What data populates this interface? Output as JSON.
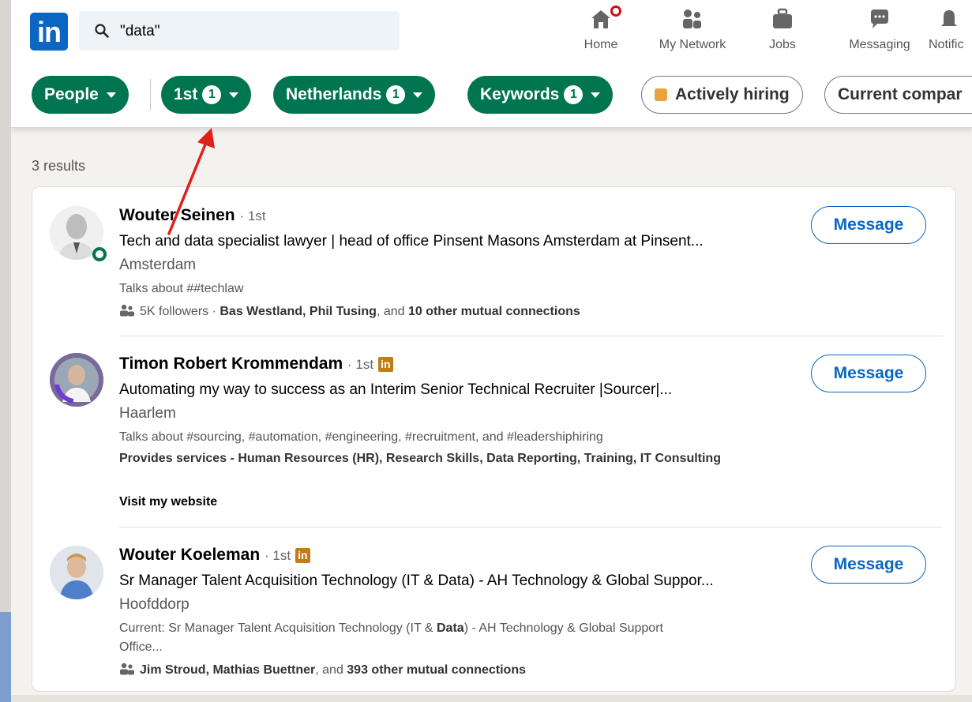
{
  "nav": {
    "search_value": "\"data\"",
    "items": [
      {
        "label": "Home",
        "icon": "home-icon"
      },
      {
        "label": "My Network",
        "icon": "my-network-icon"
      },
      {
        "label": "Jobs",
        "icon": "jobs-icon"
      },
      {
        "label": "Messaging",
        "icon": "messaging-icon"
      },
      {
        "label": "Notific",
        "icon": "notifications-icon"
      }
    ],
    "logo_text": "in"
  },
  "filters": {
    "people": "People",
    "first": "1st",
    "first_count": "1",
    "netherlands": "Netherlands",
    "netherlands_count": "1",
    "keywords": "Keywords",
    "keywords_count": "1",
    "actively_hiring": "Actively hiring",
    "current_company": "Current compar"
  },
  "results_count": "3 results",
  "results": [
    {
      "name": "Wouter Seinen",
      "degree": "· 1st",
      "headline": "Tech and data specialist lawyer | head of office Pinsent Masons Amsterdam at Pinsent...",
      "location": "Amsterdam",
      "talks": "Talks about ##techlaw",
      "followers": "5K followers · ",
      "mutual_names": "Bas Westland, Phil Tusing",
      "mutual_and": ", and ",
      "mutual_other": "10 other mutual connections",
      "button": "Message"
    },
    {
      "name": "Timon Robert Krommendam",
      "degree": "· 1st",
      "headline": "Automating my way to success as an Interim Senior Technical Recruiter |Sourcer|...",
      "location": "Haarlem",
      "talks": "Talks about #sourcing, #automation, #engineering, #recruitment, and #leadershiphiring",
      "services": "Provides services - Human Resources (HR), Research Skills, Data Reporting, Training, IT Consulting",
      "website": "Visit my website",
      "button": "Message"
    },
    {
      "name": "Wouter Koeleman",
      "degree": "· 1st",
      "headline": "Sr Manager Talent Acquisition Technology (IT & Data) - AH Technology & Global Suppor...",
      "location": "Hoofddorp",
      "current_prefix": "Current: Sr Manager Talent Acquisition Technology (IT & ",
      "current_bold": "Data",
      "current_suffix": ") - AH Technology & Global Support",
      "current_line2": "Office...",
      "mutual_names": "Jim Stroud, Mathias Buettner",
      "mutual_and": ", and ",
      "mutual_other": "393 other mutual connections",
      "button": "Message"
    }
  ],
  "colors": {
    "brand": "#0a66c2",
    "filter_green": "#01754f",
    "premium": "#c37d16",
    "annotation_arrow": "#e0201b"
  }
}
